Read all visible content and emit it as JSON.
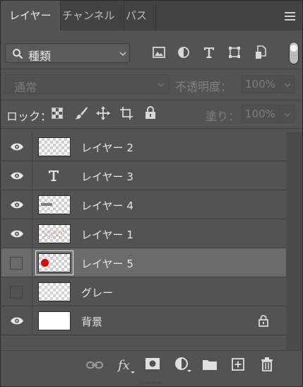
{
  "tabs": [
    {
      "label": "レイヤー",
      "active": true
    },
    {
      "label": "チャンネル",
      "active": false
    },
    {
      "label": "パス",
      "active": false
    }
  ],
  "filter": {
    "kind_label": "種類",
    "icons": [
      "image-filter-icon",
      "adjustment-filter-icon",
      "type-filter-icon",
      "shape-filter-icon",
      "smart-object-filter-icon"
    ]
  },
  "blend": {
    "mode": "通常",
    "opacity_label": "不透明度：",
    "opacity_value": "100%"
  },
  "lock": {
    "label": "ロック：",
    "fill_label": "塗り：",
    "fill_value": "100%"
  },
  "layers": [
    {
      "name": "レイヤー 2",
      "visible": true,
      "thumb": "transparent"
    },
    {
      "name": "レイヤー 3",
      "visible": true,
      "thumb": "type"
    },
    {
      "name": "レイヤー 4",
      "visible": true,
      "thumb": "dash"
    },
    {
      "name": "レイヤー 1",
      "visible": true,
      "thumb": "sketch"
    },
    {
      "name": "レイヤー 5",
      "visible": false,
      "thumb": "red-dot",
      "selected": true
    },
    {
      "name": "グレー",
      "visible": false,
      "thumb": "transparent"
    },
    {
      "name": "背景",
      "visible": true,
      "thumb": "white",
      "locked": true
    }
  ],
  "colors": {
    "panel_bg": "#535353",
    "selected_row": "#6b6b6b",
    "red_dot": "#e00000"
  }
}
